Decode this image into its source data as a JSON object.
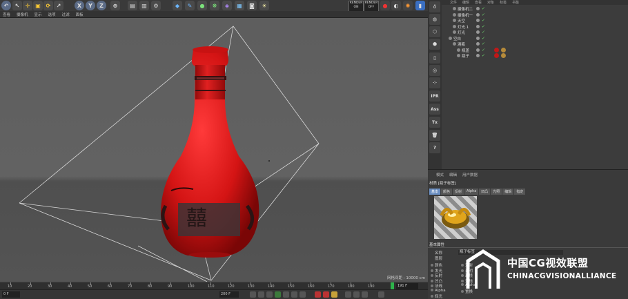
{
  "toolbar": {
    "axis_x": "X",
    "axis_y": "Y",
    "axis_z": "Z",
    "render_on": "RENDER\nON",
    "render_off": "RENDER\nOFF"
  },
  "viewport_menu": [
    "查看",
    "摄像机",
    "显示",
    "选项",
    "过滤",
    "面板"
  ],
  "viewport": {
    "grid_info": "网格间距 : 10000 cm"
  },
  "timeline": {
    "ticks": [
      "10",
      "20",
      "30",
      "40",
      "50",
      "60",
      "70",
      "80",
      "90",
      "100",
      "110",
      "120",
      "130",
      "140",
      "150",
      "160",
      "170",
      "180",
      "190"
    ],
    "current_frame_marker": "190",
    "frame_field": "191 F"
  },
  "controls": {
    "start_field": "0 F",
    "end_field": "200 F",
    "min_field": "0 F"
  },
  "palette": {
    "ipr_label": "IPR",
    "ass_label": "Ass",
    "tx_label": "Tx",
    "help_label": "?"
  },
  "object_manager": {
    "menu": [
      "文件",
      "编辑",
      "查看",
      "对象",
      "标签",
      "书签"
    ],
    "objects": [
      {
        "name": "摄像机二",
        "indent": 1
      },
      {
        "name": "摄像机一",
        "indent": 1
      },
      {
        "name": "天空",
        "indent": 1
      },
      {
        "name": "灯光.1",
        "indent": 1
      },
      {
        "name": "灯光",
        "indent": 1
      },
      {
        "name": "空白",
        "indent": 0
      },
      {
        "name": "酒瓶",
        "indent": 1
      },
      {
        "name": "瓶盖",
        "indent": 2
      },
      {
        "name": "瓶子",
        "indent": 2
      }
    ]
  },
  "attributes": {
    "menu": [
      "模式",
      "编辑",
      "用户数据"
    ],
    "title": "材质 [瓶子标签]",
    "tabs": [
      "基本",
      "颜色",
      "反射",
      "Alpha",
      "凹凸",
      "光照",
      "编辑",
      "指定"
    ],
    "section": "基本属性",
    "name_label": "名称",
    "name_value": "瓶子标签",
    "layer_label": "图层",
    "left_props": [
      "颜色",
      "发光",
      "反射",
      "凹凸",
      "法线",
      "Alpha",
      "辉光"
    ],
    "right_props": [
      "漫射",
      "透明",
      "环境",
      "法线",
      "Alpha",
      "置换"
    ]
  },
  "watermark": {
    "cn": "中国CG视效联盟",
    "en": "CHINACGVISIONALLIANCE"
  },
  "colors": {
    "bottle_red": "#d41414",
    "accent_blue": "#6b8fc2",
    "playhead_green": "#2db34a"
  }
}
